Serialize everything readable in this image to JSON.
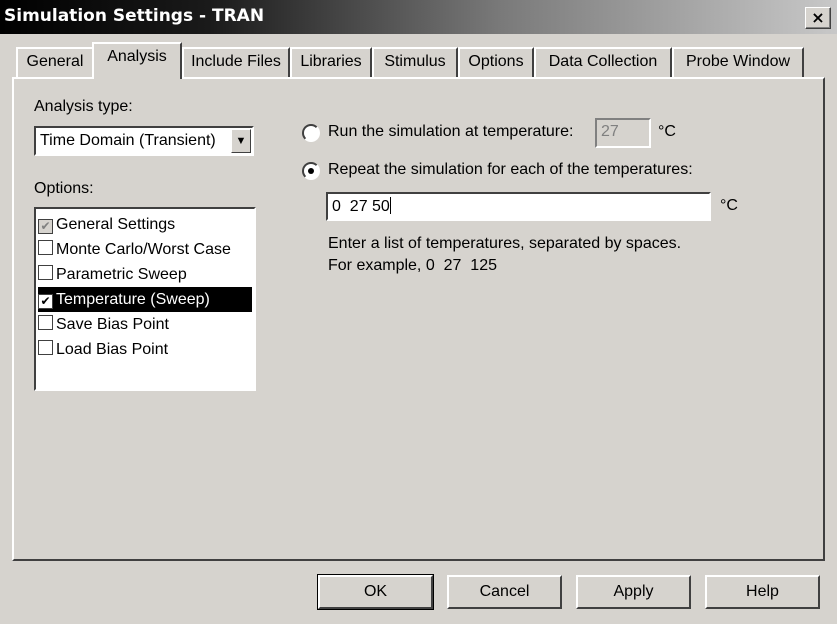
{
  "window": {
    "title": "Simulation Settings - TRAN",
    "close_glyph": "×"
  },
  "tabs": [
    {
      "label": "General"
    },
    {
      "label": "Analysis",
      "active": true
    },
    {
      "label": "Include Files"
    },
    {
      "label": "Libraries"
    },
    {
      "label": "Stimulus"
    },
    {
      "label": "Options"
    },
    {
      "label": "Data Collection"
    },
    {
      "label": "Probe Window"
    }
  ],
  "analysis_type": {
    "label": "Analysis type:",
    "value": "Time Domain (Transient)"
  },
  "options": {
    "label": "Options:",
    "items": [
      {
        "label": "General Settings",
        "checked": true,
        "disabled": true
      },
      {
        "label": "Monte Carlo/Worst Case",
        "checked": false
      },
      {
        "label": "Parametric Sweep",
        "checked": false
      },
      {
        "label": "Temperature (Sweep)",
        "checked": true,
        "selected": true
      },
      {
        "label": "Save Bias Point",
        "checked": false
      },
      {
        "label": "Load Bias Point",
        "checked": false
      }
    ]
  },
  "temperature": {
    "run_at_label": "Run the simulation at temperature:",
    "run_at_value": "27",
    "unit": "°C",
    "repeat_label": "Repeat the simulation for each of the temperatures:",
    "repeat_value": "0  27 50",
    "hint_line1": "Enter a list of temperatures, separated by spaces.",
    "hint_line2": "For example, 0  27  125",
    "selected_option": "repeat"
  },
  "buttons": {
    "ok": "OK",
    "cancel": "Cancel",
    "apply": "Apply",
    "help": "Help"
  },
  "icons": {
    "checkmark": "✔",
    "combo_arrow": "▼"
  }
}
